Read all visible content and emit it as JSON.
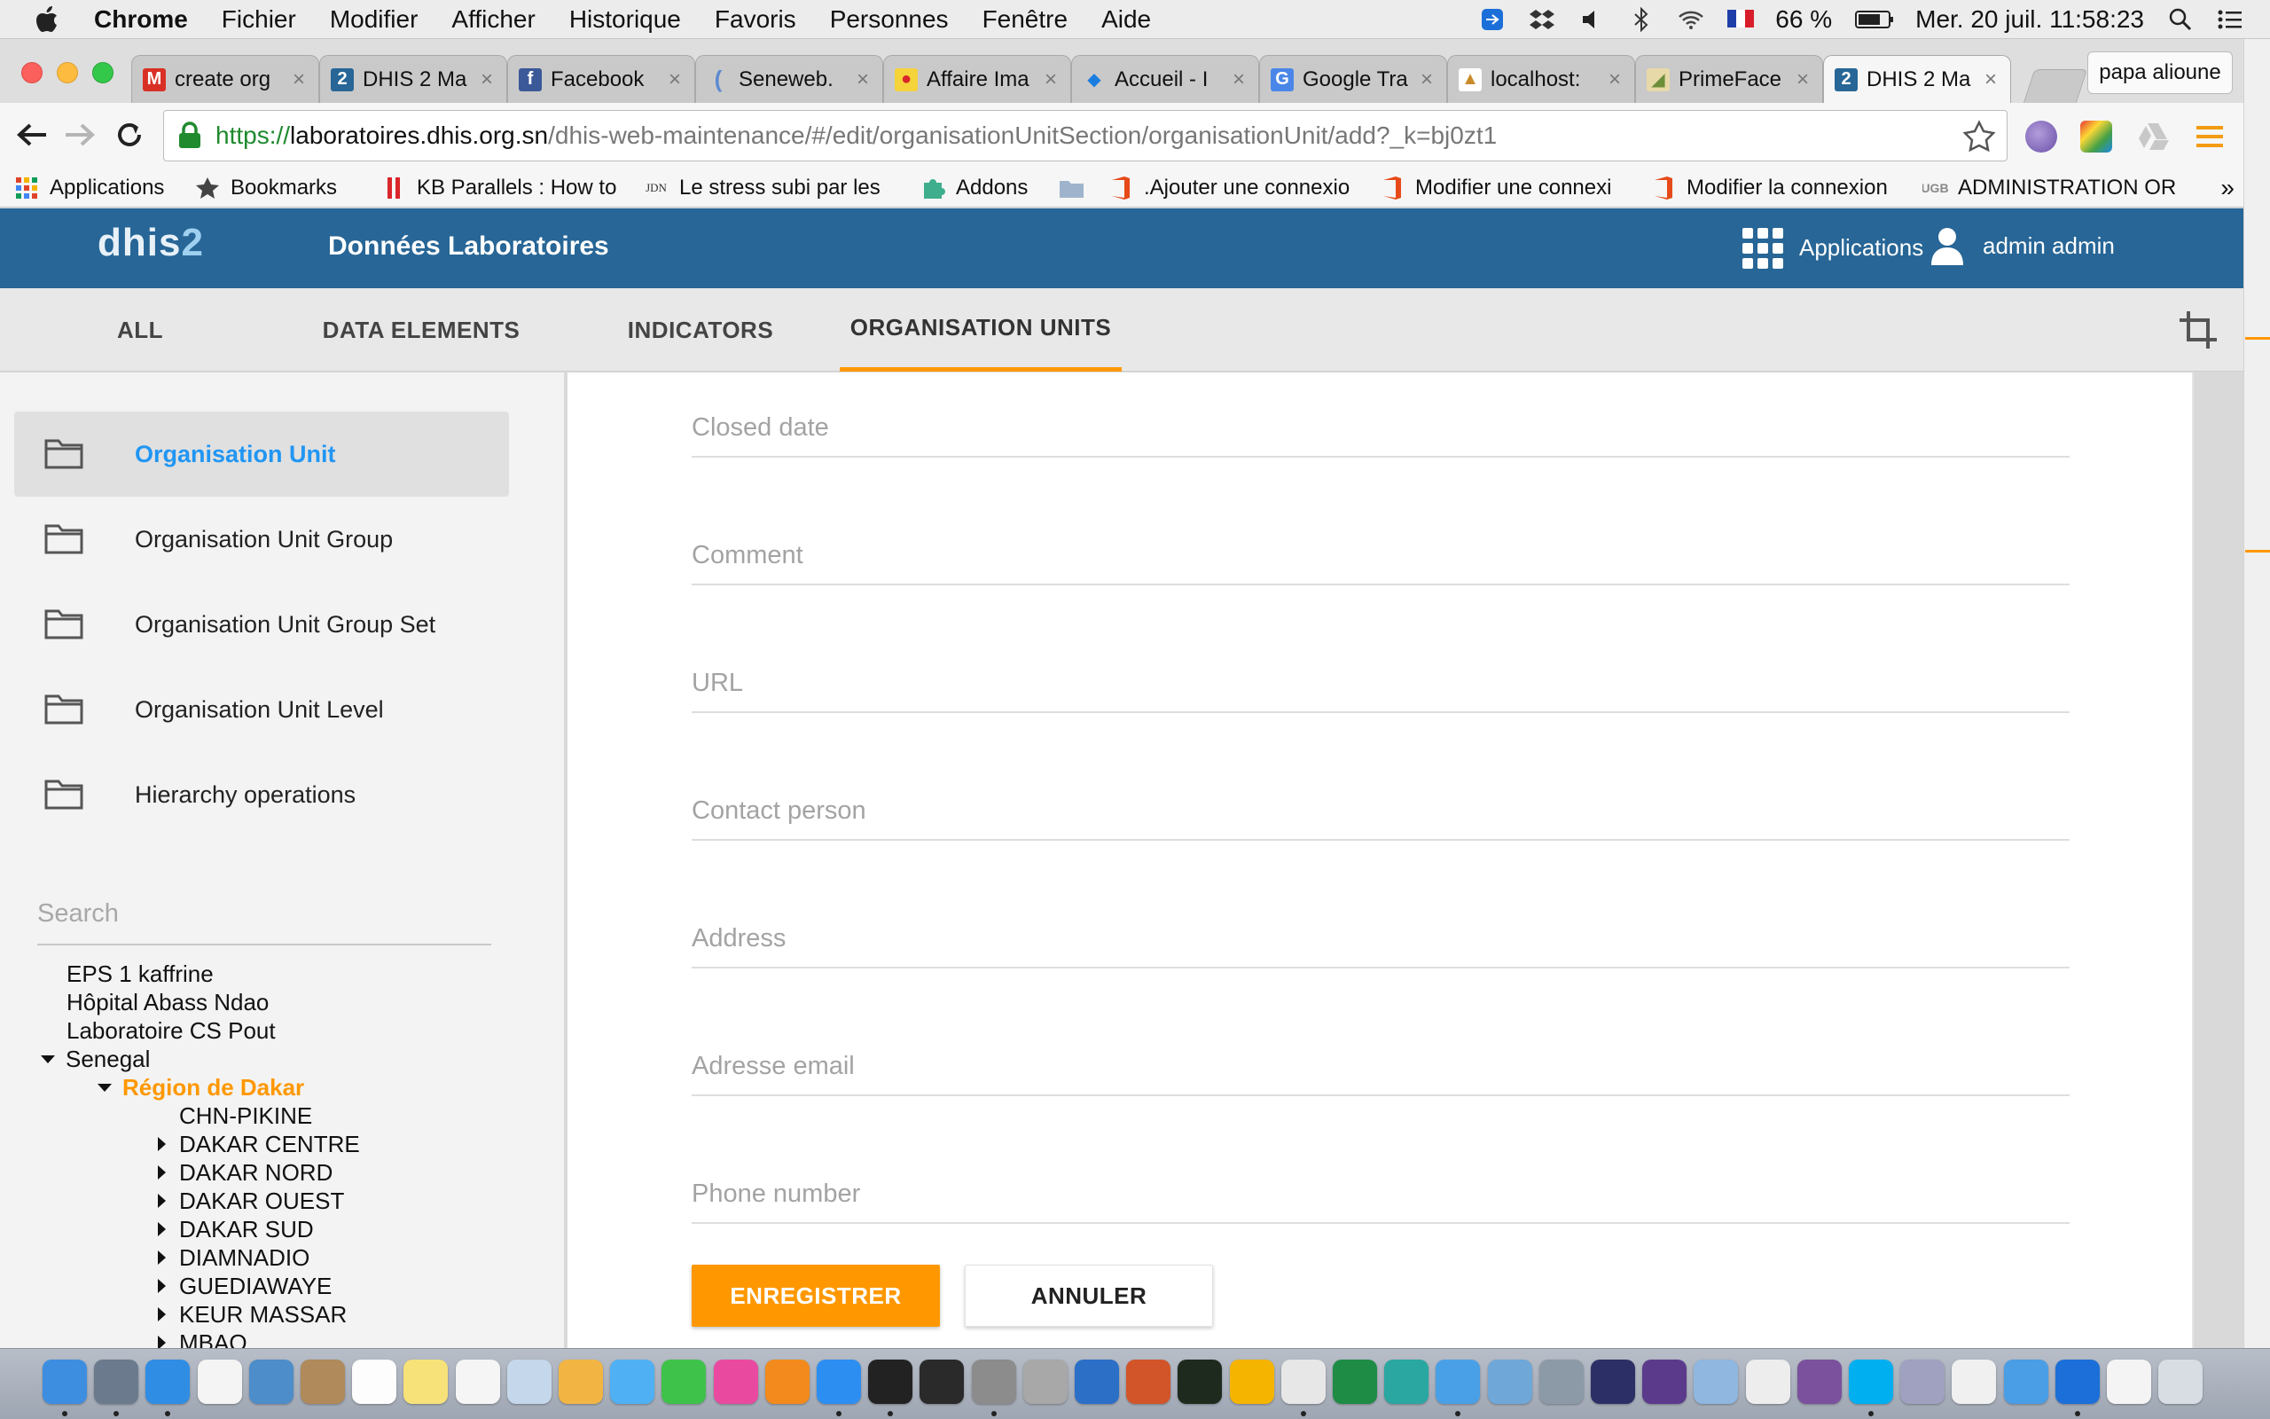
{
  "menubar": {
    "app_name": "Chrome",
    "menus": [
      "Fichier",
      "Modifier",
      "Afficher",
      "Historique",
      "Favoris",
      "Personnes",
      "Fenêtre",
      "Aide"
    ],
    "battery": "66 %",
    "clock": "Mer. 20 juil.  11:58:23"
  },
  "browser": {
    "tabs": [
      {
        "label": "create org",
        "fav": "M",
        "color": "#d93025"
      },
      {
        "label": "DHIS 2 Ma",
        "fav": "2",
        "color": "#276696"
      },
      {
        "label": "Facebook",
        "fav": "f",
        "color": "#3b5998"
      },
      {
        "label": "Seneweb.",
        "fav": "(",
        "color": "#5b8bd0"
      },
      {
        "label": "Affaire Ima",
        "fav": "●",
        "color": "#e0922b"
      },
      {
        "label": "Accueil - I",
        "fav": "◆",
        "color": "#1b7de0"
      },
      {
        "label": "Google Tra",
        "fav": "G",
        "color": "#4a86e8"
      },
      {
        "label": "localhost:",
        "fav": "▲",
        "color": "#c98b2a"
      },
      {
        "label": "PrimeFace",
        "fav": "◢",
        "color": "#6d8f3a"
      },
      {
        "label": "DHIS 2 Ma",
        "fav": "2",
        "color": "#276696"
      }
    ],
    "profile_name": "papa alioune",
    "url": {
      "scheme": "https://",
      "host": "laboratoires.dhis.org.sn",
      "path": "/dhis-web-maintenance/#/edit/organisationUnitSection/organisationUnit/add?_k=bj0zt1"
    },
    "bookmarks": [
      {
        "label": "Applications",
        "icon": "apps-grid",
        "color": "#e0432b"
      },
      {
        "label": "Bookmarks",
        "icon": "star",
        "color": "#444"
      },
      {
        "label": "KB Parallels : How to",
        "icon": "parallels",
        "color": "#d9262b"
      },
      {
        "label": "Le stress subi par les",
        "icon": "jdn",
        "color": "#333"
      },
      {
        "label": "Addons",
        "icon": "puzzle",
        "color": "#3fae8c"
      },
      {
        "label": "",
        "icon": "folder",
        "color": "#8aa0b8"
      },
      {
        "label": ".Ajouter une connexio",
        "icon": "office",
        "color": "#e64a19"
      },
      {
        "label": "Modifier une connexi",
        "icon": "office",
        "color": "#e64a19"
      },
      {
        "label": "Modifier la connexion",
        "icon": "office",
        "color": "#e64a19"
      },
      {
        "label": "ADMINISTRATION OR",
        "icon": "ucad",
        "color": "#888"
      }
    ],
    "bookmarks_more": "»"
  },
  "header": {
    "logo": "dhis",
    "logo_suffix": "2",
    "title": "Données Laboratoires",
    "apps_label": "Applications",
    "user_label": "admin admin"
  },
  "section_tabs": [
    {
      "label": "ALL",
      "active": false
    },
    {
      "label": "DATA ELEMENTS",
      "active": false
    },
    {
      "label": "INDICATORS",
      "active": false
    },
    {
      "label": "ORGANISATION UNITS",
      "active": true
    }
  ],
  "sidebar": {
    "items": [
      {
        "label": "Organisation Unit",
        "active": true
      },
      {
        "label": "Organisation Unit Group",
        "active": false
      },
      {
        "label": "Organisation Unit Group Set",
        "active": false
      },
      {
        "label": "Organisation Unit Level",
        "active": false
      },
      {
        "label": "Hierarchy operations",
        "active": false
      }
    ],
    "search_placeholder": "Search",
    "tree": [
      {
        "label": "EPS 1 kaffrine",
        "level": 0,
        "arrow": "none"
      },
      {
        "label": "Hôpital Abass Ndao",
        "level": 0,
        "arrow": "none"
      },
      {
        "label": "Laboratoire CS Pout",
        "level": 0,
        "arrow": "none"
      },
      {
        "label": "Senegal",
        "level": 0,
        "arrow": "down"
      },
      {
        "label": "Région de Dakar",
        "level": 1,
        "arrow": "down",
        "selected": true
      },
      {
        "label": "CHN-PIKINE",
        "level": 2,
        "arrow": "none"
      },
      {
        "label": "DAKAR CENTRE",
        "level": 2,
        "arrow": "right"
      },
      {
        "label": "DAKAR NORD",
        "level": 2,
        "arrow": "right"
      },
      {
        "label": "DAKAR OUEST",
        "level": 2,
        "arrow": "right"
      },
      {
        "label": "DAKAR SUD",
        "level": 2,
        "arrow": "right"
      },
      {
        "label": "DIAMNADIO",
        "level": 2,
        "arrow": "right"
      },
      {
        "label": "GUEDIAWAYE",
        "level": 2,
        "arrow": "right"
      },
      {
        "label": "KEUR MASSAR",
        "level": 2,
        "arrow": "right"
      },
      {
        "label": "MBAO",
        "level": 2,
        "arrow": "right"
      }
    ]
  },
  "form": {
    "fields": [
      {
        "name": "closed-date-field",
        "placeholder": "Closed date",
        "value": ""
      },
      {
        "name": "comment-field",
        "placeholder": "Comment",
        "value": ""
      },
      {
        "name": "url-field",
        "placeholder": "URL",
        "value": ""
      },
      {
        "name": "contact-person-field",
        "placeholder": "Contact person",
        "value": ""
      },
      {
        "name": "address-field",
        "placeholder": "Address",
        "value": ""
      },
      {
        "name": "email-field",
        "placeholder": "Adresse email",
        "value": ""
      },
      {
        "name": "phone-number-field",
        "placeholder": "Phone number",
        "value": ""
      }
    ],
    "save_label": "ENREGISTRER",
    "cancel_label": "ANNULER"
  },
  "colors": {
    "header_blue": "#276696",
    "accent_orange": "#ff9800",
    "active_link_blue": "#2196f3"
  },
  "dock": {
    "apps": [
      {
        "name": "finder-icon",
        "color": "#3d8ee0"
      },
      {
        "name": "launchpad-icon",
        "color": "#6b7a8c"
      },
      {
        "name": "safari-icon",
        "color": "#2f8de4"
      },
      {
        "name": "grid-app-icon",
        "color": "#f4f4f4"
      },
      {
        "name": "mail-stamp-icon",
        "color": "#4d8dc9"
      },
      {
        "name": "contacts-icon",
        "color": "#b08a5a"
      },
      {
        "name": "calendar-icon",
        "color": "#fdfdfd"
      },
      {
        "name": "notes-icon",
        "color": "#f7e27a"
      },
      {
        "name": "reminders-icon",
        "color": "#f5f5f5"
      },
      {
        "name": "preview-icon",
        "color": "#c5d7ea"
      },
      {
        "name": "photos-icon",
        "color": "#f2b544"
      },
      {
        "name": "messages-icon",
        "color": "#4fb0f3"
      },
      {
        "name": "facetime-icon",
        "color": "#3fc24a"
      },
      {
        "name": "itunes-icon",
        "color": "#e94aa0"
      },
      {
        "name": "ibooks-icon",
        "color": "#f28a1d"
      },
      {
        "name": "appstore-icon",
        "color": "#2d8ef1"
      },
      {
        "name": "terminal-icon",
        "color": "#222"
      },
      {
        "name": "terminal2-icon",
        "color": "#2a2a2a"
      },
      {
        "name": "system-prefs-icon",
        "color": "#8c8c8c"
      },
      {
        "name": "disk-util-icon",
        "color": "#a8a8a8"
      },
      {
        "name": "word-icon",
        "color": "#2b6fc7"
      },
      {
        "name": "powerpoint-icon",
        "color": "#d2552a"
      },
      {
        "name": "activity-monitor-icon",
        "color": "#1f2a1f"
      },
      {
        "name": "outlook-icon",
        "color": "#f5b400"
      },
      {
        "name": "chrome-icon",
        "color": "#e7e7e7"
      },
      {
        "name": "excel-icon",
        "color": "#1e8c45"
      },
      {
        "name": "c-app-icon",
        "color": "#2aa7a0"
      },
      {
        "name": "people-icon",
        "color": "#4aa0e6"
      },
      {
        "name": "network-icon",
        "color": "#6fa7d8"
      },
      {
        "name": "archive-icon",
        "color": "#8c9aa8"
      },
      {
        "name": "eclipse-icon",
        "color": "#2c2f66"
      },
      {
        "name": "eclipse2-icon",
        "color": "#5b3a8c"
      },
      {
        "name": "virtualbox-icon",
        "color": "#8fb7e0"
      },
      {
        "name": "sequel-icon",
        "color": "#ededed"
      },
      {
        "name": "viber-icon",
        "color": "#7b519d"
      },
      {
        "name": "skype-icon",
        "color": "#00aff0"
      },
      {
        "name": "lotus-icon",
        "color": "#a0a0c0"
      },
      {
        "name": "script-icon",
        "color": "#f0f0f0"
      },
      {
        "name": "users-icon",
        "color": "#4a9ee6"
      },
      {
        "name": "teamviewer-icon",
        "color": "#1c6fd8"
      },
      {
        "name": "document-icon",
        "color": "#f4f4f4"
      },
      {
        "name": "trash-icon",
        "color": "#d8dde3"
      }
    ]
  }
}
